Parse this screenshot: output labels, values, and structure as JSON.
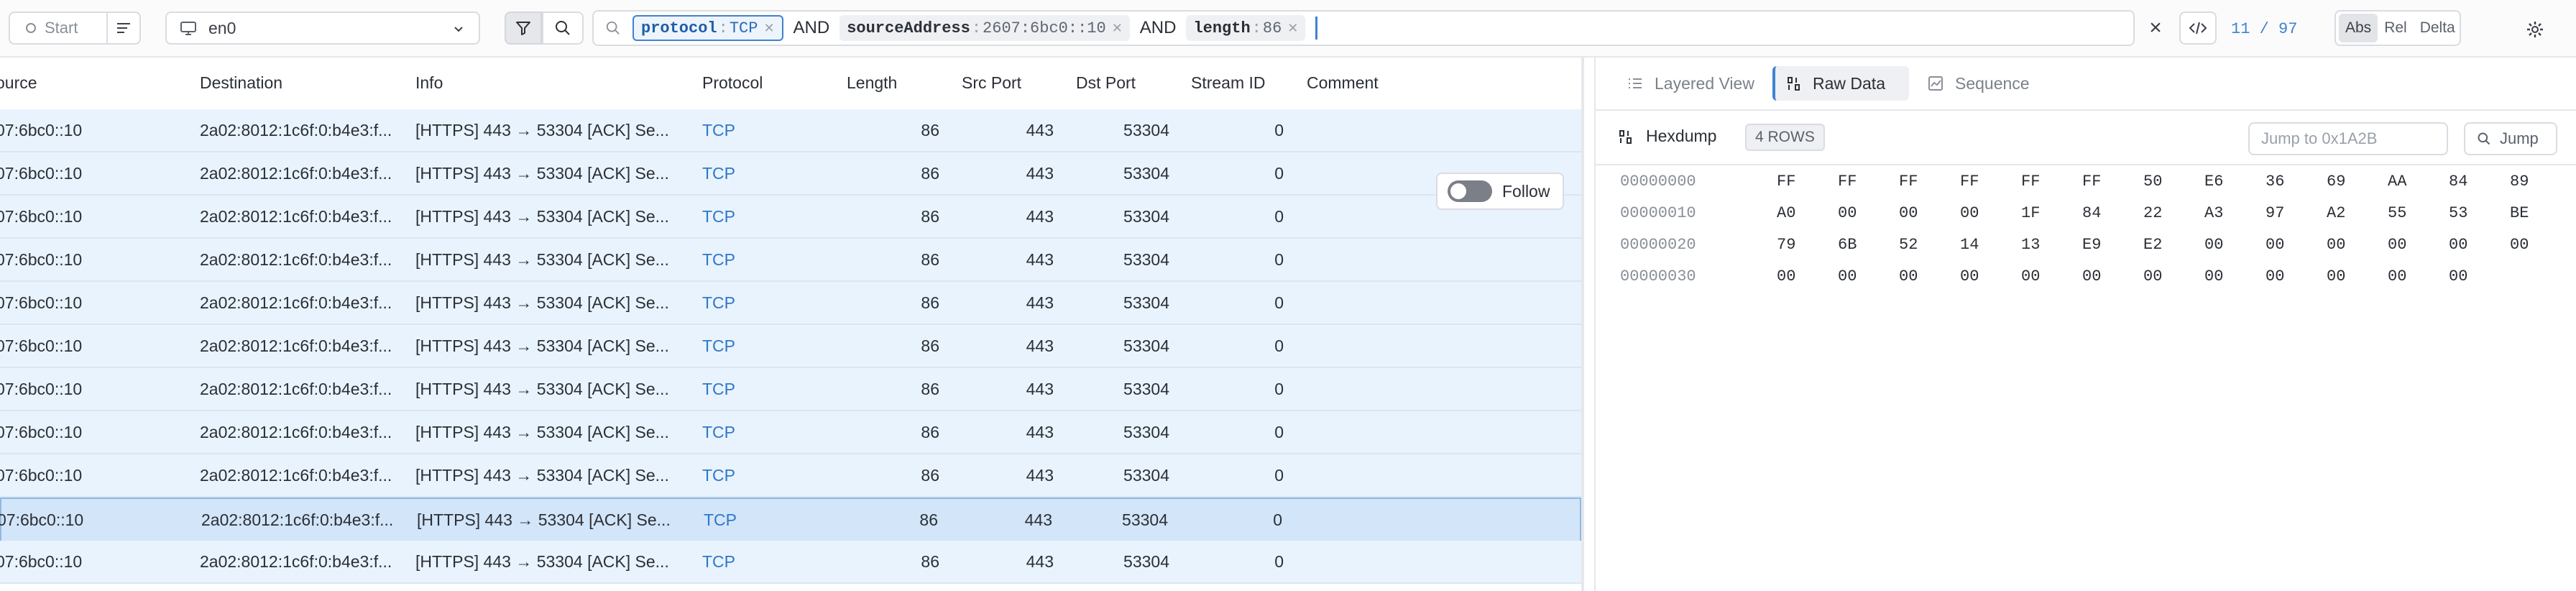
{
  "toolbar": {
    "start_label": "Start",
    "interface_value": "en0",
    "query_tokens": [
      {
        "key": "protocol",
        "value": "TCP"
      },
      {
        "key": "sourceAddress",
        "value": "2607:6bc0::10"
      },
      {
        "key": "length",
        "value": "86"
      }
    ],
    "and_label": "AND",
    "clear_label": "×",
    "counter_current": "11",
    "counter_sep": "/",
    "counter_total": "97",
    "time_modes": [
      "Abs",
      "Rel",
      "Delta"
    ],
    "time_mode_selected": "Abs",
    "accent_color": "#3e83d1"
  },
  "table": {
    "columns": [
      "ource",
      "Destination",
      "Info",
      "Protocol",
      "Length",
      "Src Port",
      "Dst Port",
      "Stream ID",
      "Comment"
    ],
    "rows": [
      {
        "source": "07:6bc0::10",
        "destination": "2a02:8012:1c6f:0:b4e3:f...",
        "info": "[HTTPS] 443 → 53304 [ACK] Se...",
        "protocol": "TCP",
        "length": "86",
        "src_port": "443",
        "dst_port": "53304",
        "stream_id": "0",
        "comment": ""
      },
      {
        "source": "07:6bc0::10",
        "destination": "2a02:8012:1c6f:0:b4e3:f...",
        "info": "[HTTPS] 443 → 53304 [ACK] Se...",
        "protocol": "TCP",
        "length": "86",
        "src_port": "443",
        "dst_port": "53304",
        "stream_id": "0",
        "comment": ""
      },
      {
        "source": "07:6bc0::10",
        "destination": "2a02:8012:1c6f:0:b4e3:f...",
        "info": "[HTTPS] 443 → 53304 [ACK] Se...",
        "protocol": "TCP",
        "length": "86",
        "src_port": "443",
        "dst_port": "53304",
        "stream_id": "0",
        "comment": ""
      },
      {
        "source": "07:6bc0::10",
        "destination": "2a02:8012:1c6f:0:b4e3:f...",
        "info": "[HTTPS] 443 → 53304 [ACK] Se...",
        "protocol": "TCP",
        "length": "86",
        "src_port": "443",
        "dst_port": "53304",
        "stream_id": "0",
        "comment": ""
      },
      {
        "source": "07:6bc0::10",
        "destination": "2a02:8012:1c6f:0:b4e3:f...",
        "info": "[HTTPS] 443 → 53304 [ACK] Se...",
        "protocol": "TCP",
        "length": "86",
        "src_port": "443",
        "dst_port": "53304",
        "stream_id": "0",
        "comment": ""
      },
      {
        "source": "07:6bc0::10",
        "destination": "2a02:8012:1c6f:0:b4e3:f...",
        "info": "[HTTPS] 443 → 53304 [ACK] Se...",
        "protocol": "TCP",
        "length": "86",
        "src_port": "443",
        "dst_port": "53304",
        "stream_id": "0",
        "comment": ""
      },
      {
        "source": "07:6bc0::10",
        "destination": "2a02:8012:1c6f:0:b4e3:f...",
        "info": "[HTTPS] 443 → 53304 [ACK] Se...",
        "protocol": "TCP",
        "length": "86",
        "src_port": "443",
        "dst_port": "53304",
        "stream_id": "0",
        "comment": ""
      },
      {
        "source": "07:6bc0::10",
        "destination": "2a02:8012:1c6f:0:b4e3:f...",
        "info": "[HTTPS] 443 → 53304 [ACK] Se...",
        "protocol": "TCP",
        "length": "86",
        "src_port": "443",
        "dst_port": "53304",
        "stream_id": "0",
        "comment": ""
      },
      {
        "source": "07:6bc0::10",
        "destination": "2a02:8012:1c6f:0:b4e3:f...",
        "info": "[HTTPS] 443 → 53304 [ACK] Se...",
        "protocol": "TCP",
        "length": "86",
        "src_port": "443",
        "dst_port": "53304",
        "stream_id": "0",
        "comment": ""
      },
      {
        "source": "07:6bc0::10",
        "destination": "2a02:8012:1c6f:0:b4e3:f...",
        "info": "[HTTPS] 443 → 53304 [ACK] Se...",
        "protocol": "TCP",
        "length": "86",
        "src_port": "443",
        "dst_port": "53304",
        "stream_id": "0",
        "comment": "",
        "selected": true
      },
      {
        "source": "07:6bc0::10",
        "destination": "2a02:8012:1c6f:0:b4e3:f...",
        "info": "[HTTPS] 443 → 53304 [ACK] Se...",
        "protocol": "TCP",
        "length": "86",
        "src_port": "443",
        "dst_port": "53304",
        "stream_id": "0",
        "comment": ""
      }
    ],
    "follow_label": "Follow",
    "follow_enabled": true
  },
  "detail": {
    "tabs": [
      "Layered View",
      "Raw Data",
      "Sequence"
    ],
    "active_tab": "Raw Data",
    "hexdump_label": "Hexdump",
    "rows_badge": "4 ROWS",
    "jump_placeholder": "Jump to 0x1A2B",
    "jump_button": "Jump",
    "hex_rows": [
      {
        "offset": "00000000",
        "bytes": [
          "FF",
          "FF",
          "FF",
          "FF",
          "FF",
          "FF",
          "50",
          "E6",
          "36",
          "69",
          "AA",
          "84",
          "89"
        ]
      },
      {
        "offset": "00000010",
        "bytes": [
          "A0",
          "00",
          "00",
          "00",
          "1F",
          "84",
          "22",
          "A3",
          "97",
          "A2",
          "55",
          "53",
          "BE"
        ]
      },
      {
        "offset": "00000020",
        "bytes": [
          "79",
          "6B",
          "52",
          "14",
          "13",
          "E9",
          "E2",
          "00",
          "00",
          "00",
          "00",
          "00",
          "00"
        ]
      },
      {
        "offset": "00000030",
        "bytes": [
          "00",
          "00",
          "00",
          "00",
          "00",
          "00",
          "00",
          "00",
          "00",
          "00",
          "00",
          "00"
        ]
      }
    ]
  }
}
